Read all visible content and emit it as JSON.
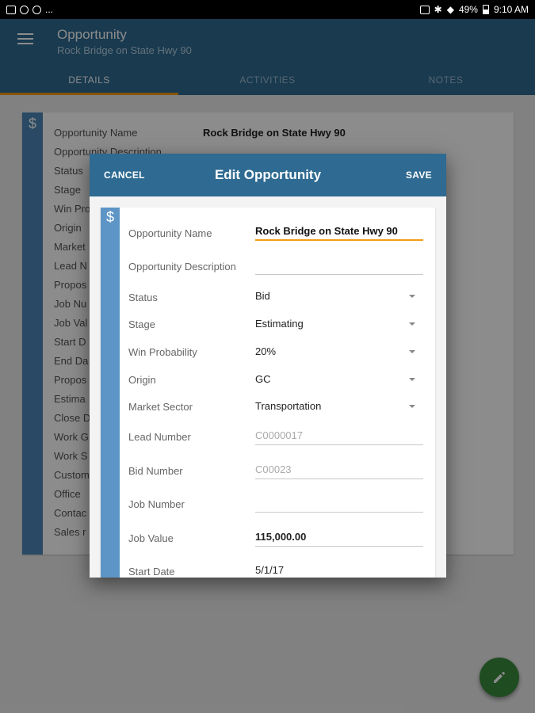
{
  "status_bar": {
    "battery": "49%",
    "time": "9:10 AM",
    "more": "..."
  },
  "app_bar": {
    "title": "Opportunity",
    "subtitle": "Rock Bridge on State Hwy 90",
    "tabs": [
      {
        "label": "DETAILS",
        "active": true
      },
      {
        "label": "ACTIVITIES",
        "active": false
      },
      {
        "label": "NOTES",
        "active": false
      }
    ]
  },
  "background_card": {
    "icon": "$",
    "labels": [
      "Opportunity Name",
      "Opportunity Description",
      "Status",
      "Stage",
      "Win Pro",
      "Origin",
      "Market",
      "Lead N",
      "Propos",
      "Job Nu",
      "Job Val",
      "Start D",
      "End Da",
      "Propos",
      "Estima",
      "Close D",
      "Work G",
      "Work S",
      "Custom",
      "Office",
      "Contac",
      "Sales r"
    ],
    "name_value": "Rock Bridge on State Hwy 90"
  },
  "dialog": {
    "cancel_label": "CANCEL",
    "title": "Edit Opportunity",
    "save_label": "SAVE",
    "icon": "$",
    "fields": {
      "opportunity_name": {
        "label": "Opportunity Name",
        "value": "Rock Bridge on State Hwy 90"
      },
      "opportunity_description": {
        "label": "Opportunity Description",
        "value": ""
      },
      "status": {
        "label": "Status",
        "value": "Bid"
      },
      "stage": {
        "label": "Stage",
        "value": "Estimating"
      },
      "win_probability": {
        "label": "Win Probability",
        "value": "20%"
      },
      "origin": {
        "label": "Origin",
        "value": "GC"
      },
      "market_sector": {
        "label": "Market Sector",
        "value": "Transportation"
      },
      "lead_number": {
        "label": "Lead Number",
        "value": "C0000017"
      },
      "bid_number": {
        "label": "Bid Number",
        "value": "C00023"
      },
      "job_number": {
        "label": "Job Number",
        "value": ""
      },
      "job_value": {
        "label": "Job Value",
        "value": "115,000.00"
      },
      "start_date": {
        "label": "Start Date",
        "value": "5/1/17"
      }
    }
  },
  "colors": {
    "primary": "#2e6a91",
    "accent": "#f39c12",
    "stripe": "#4c86b6",
    "fab": "#3b8a3f"
  },
  "icons": {
    "menu": "menu-icon",
    "fab": "pencil-icon"
  }
}
